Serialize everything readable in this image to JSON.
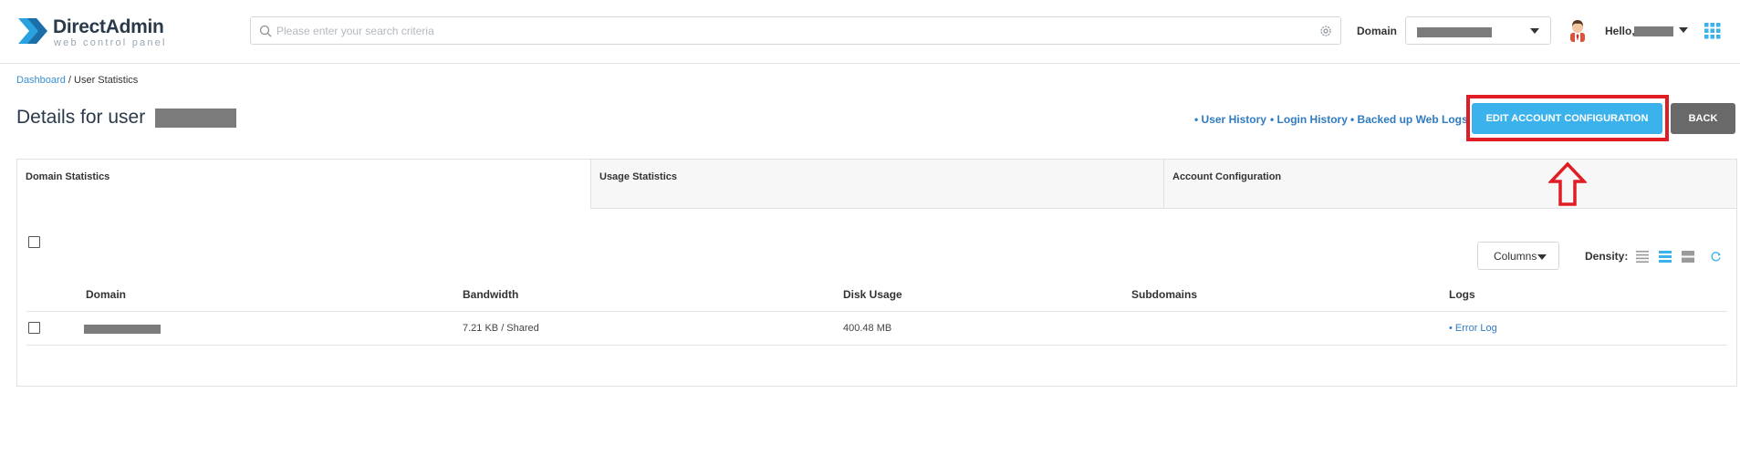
{
  "header": {
    "logo_title": "DirectAdmin",
    "logo_subtitle": "web control panel",
    "search_placeholder": "Please enter your search criteria",
    "domain_label": "Domain",
    "hello_label": "Hello,"
  },
  "breadcrumb": {
    "home": "Dashboard",
    "separator": "/",
    "current": "User Statistics"
  },
  "page": {
    "title": "Details for user",
    "links": [
      "User History",
      "Login History",
      "Backed up Web Logs"
    ],
    "link_bullet": "•",
    "edit_button": "EDIT ACCOUNT CONFIGURATION",
    "back_button": "BACK"
  },
  "tabs": [
    "Domain Statistics",
    "Usage Statistics",
    "Account Configuration"
  ],
  "toolbar": {
    "columns_label": "Columns",
    "density_label": "Density:"
  },
  "table": {
    "headers": [
      "Domain",
      "Bandwidth",
      "Disk Usage",
      "Subdomains",
      "Logs"
    ],
    "rows": [
      {
        "bandwidth": "7.21 KB / Shared",
        "disk_usage": "400.48 MB",
        "subdomains": "",
        "logs": "Error Log",
        "logs_bullet": "•"
      }
    ]
  },
  "colors": {
    "accent": "#3bb2ec",
    "link": "#2f7bc2",
    "highlight": "#e01c24",
    "back_button": "#696969"
  },
  "icons": {
    "logo": "directadmin-logo-icon",
    "search": "search-icon",
    "settings": "gear-icon",
    "avatar": "avatar-icon",
    "apps": "grid-apps-icon",
    "arrow": "up-arrow-icon",
    "refresh": "refresh-icon"
  }
}
